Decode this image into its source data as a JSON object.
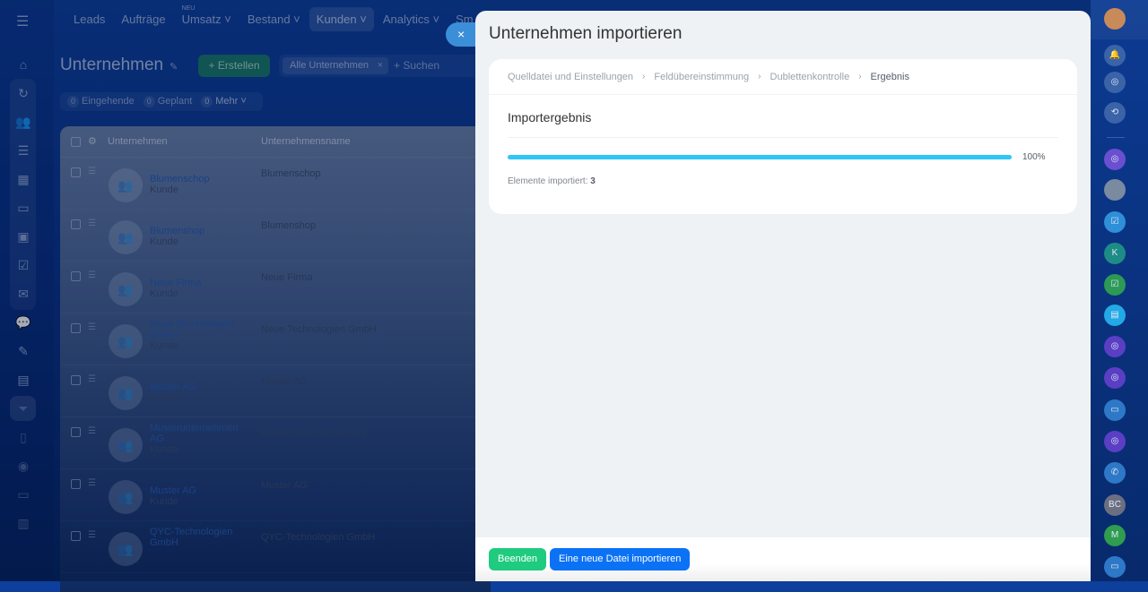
{
  "left_sidebar": {
    "menu_icon": "hamburger-icon",
    "icons": [
      "home-icon",
      "sync-icon",
      "contacts-icon",
      "document-list-icon",
      "calendar-icon",
      "storage-icon",
      "presentation-icon",
      "task-check-icon",
      "mail-icon",
      "chat-icon",
      "signature-icon",
      "inventory-icon",
      "filter-funnel-icon",
      "file-icon",
      "camera-icon",
      "card-icon",
      "chart-icon"
    ]
  },
  "topnav": {
    "items": [
      {
        "label": "Leads"
      },
      {
        "label": "Aufträge"
      },
      {
        "label": "Umsatz",
        "badge": "NEU",
        "dropdown": true
      },
      {
        "label": "Bestand",
        "dropdown": true
      },
      {
        "label": "Kunden",
        "dropdown": true,
        "active": true
      },
      {
        "label": "Analytics",
        "dropdown": true
      },
      {
        "label": "Sm"
      }
    ]
  },
  "page": {
    "title": "Unternehmen",
    "create_label": "Erstellen",
    "filter_chip": "Alle Unternehmen",
    "search_placeholder": "+ Suchen",
    "counters": [
      {
        "count": "0",
        "label": "Eingehende"
      },
      {
        "count": "0",
        "label": "Geplant"
      },
      {
        "count": "0",
        "label": "Mehr"
      }
    ]
  },
  "table": {
    "headers": [
      "Unternehmen",
      "Unternehmensname"
    ],
    "rows": [
      {
        "name": "Blumenschop",
        "type": "Kunde",
        "company": "Blumenschop"
      },
      {
        "name": "Blumenshop",
        "type": "Kunde",
        "company": "Blumenshop"
      },
      {
        "name": "Neue Firma",
        "type": "Kunde",
        "company": "Neue Firma"
      },
      {
        "name": "Neue Technologien GmbH",
        "type": "Kunde",
        "company": "Neue Technologien GmbH"
      },
      {
        "name": "Muster AG",
        "type": "Kunde",
        "company": "Muster AG"
      },
      {
        "name": "Musterunternehmen AG",
        "type": "Kunde",
        "company": "Musterunternehmen AG"
      },
      {
        "name": "Muster AG",
        "type": "Kunde",
        "company": "Muster AG"
      },
      {
        "name": "QYC-Technologien GmbH",
        "type": "",
        "company": "QYC-Technologien GmbH"
      }
    ]
  },
  "slider": {
    "close": "×",
    "title": "Unternehmen importieren",
    "steps": [
      "Quelldatei und Einstellungen",
      "Feldübereinstimmung",
      "Dublettenkontrolle",
      "Ergebnis"
    ],
    "result_title": "Importergebnis",
    "progress_percent": 100,
    "progress_label": "100%",
    "imported_label": "Elemente importiert:",
    "imported_count": "3",
    "buttons": {
      "finish": "Beenden",
      "import_new": "Eine neue Datei importieren"
    }
  },
  "right_bar": {
    "items": [
      {
        "icon": "user-avatar",
        "bg": "#c98a5a",
        "text": ""
      },
      {
        "icon": "bell-icon",
        "bg": "#3a63a8",
        "text": "🔔"
      },
      {
        "icon": "openlines-icon",
        "bg": "#3a63a8",
        "text": "◎"
      },
      {
        "icon": "chat-sync-icon",
        "bg": "#3a63a8",
        "text": "⟲"
      },
      {
        "icon": "channel-icon",
        "bg": "#6a4fd0",
        "text": "◎"
      },
      {
        "icon": "user-avatar",
        "bg": "#7a8aa0",
        "text": ""
      },
      {
        "icon": "task-chat-icon",
        "bg": "#2f8fd8",
        "text": "☑"
      },
      {
        "icon": "initial-avatar",
        "bg": "#1e8c86",
        "text": "K"
      },
      {
        "icon": "task-chat-icon",
        "bg": "#2c9a55",
        "text": "☑"
      },
      {
        "icon": "messages-icon",
        "bg": "#22a9e6",
        "text": "▤"
      },
      {
        "icon": "channel-icon",
        "bg": "#5a3fc4",
        "text": "◎"
      },
      {
        "icon": "channel-icon",
        "bg": "#5a3fc4",
        "text": "◎"
      },
      {
        "icon": "contact-card-icon",
        "bg": "#2e78c8",
        "text": "▭"
      },
      {
        "icon": "channel-icon",
        "bg": "#5a3fc4",
        "text": "◎"
      },
      {
        "icon": "phone-icon",
        "bg": "#2e78c8",
        "text": "✆"
      },
      {
        "icon": "initial-avatar",
        "bg": "#6b6f82",
        "text": "BC"
      },
      {
        "icon": "initial-avatar",
        "bg": "#2f9c50",
        "text": "M"
      },
      {
        "icon": "contact-card-icon",
        "bg": "#2e78c8",
        "text": "▭"
      }
    ]
  }
}
